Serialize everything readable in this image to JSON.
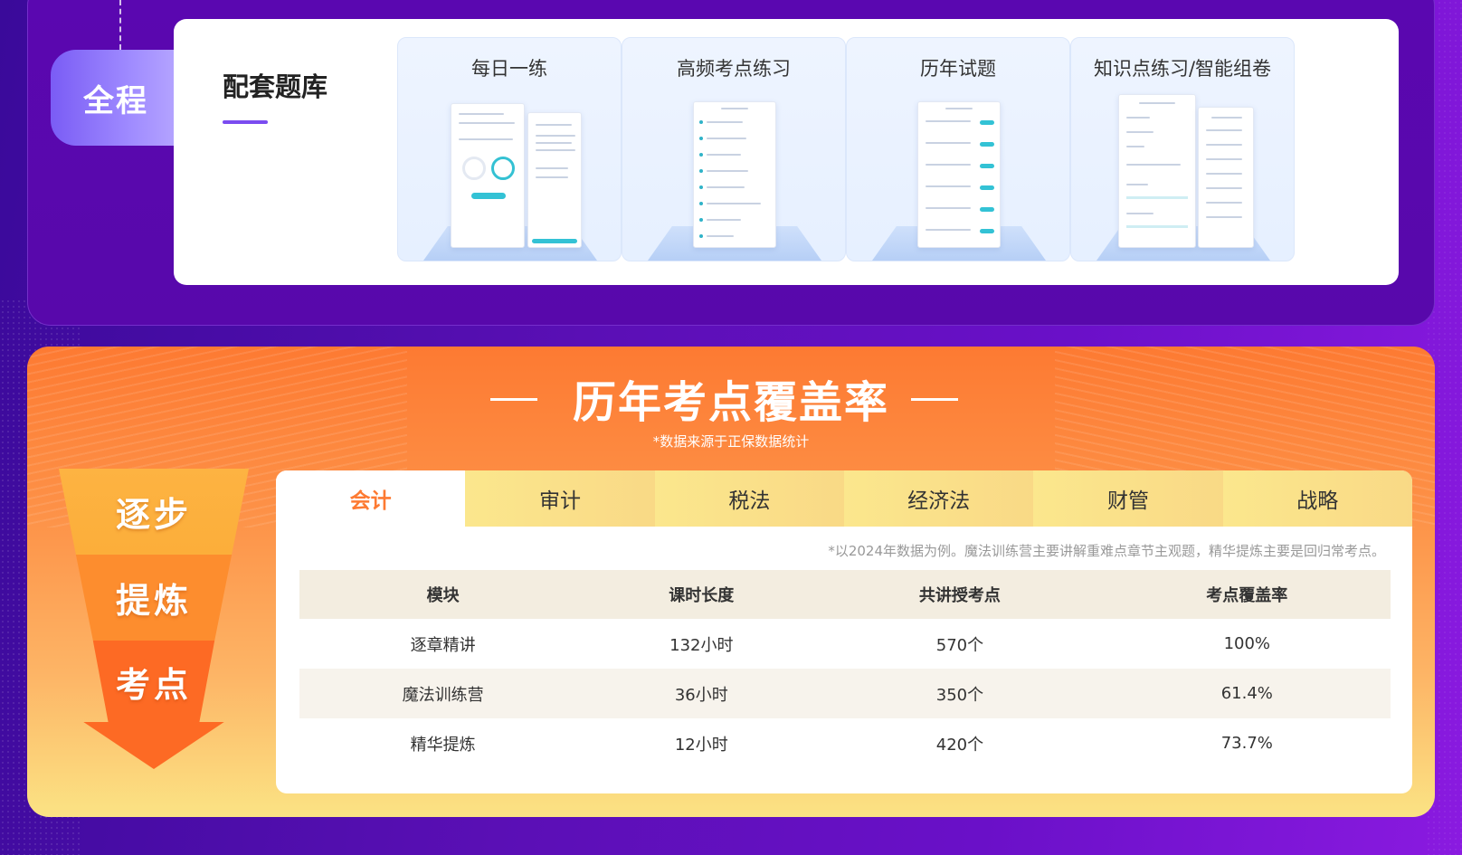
{
  "top": {
    "phase_tag": "全程",
    "section_title": "配套题库",
    "items": [
      {
        "label": "每日一练"
      },
      {
        "label": "高频考点练习"
      },
      {
        "label": "历年试题"
      },
      {
        "label": "知识点练习/智能组卷"
      }
    ]
  },
  "coverage": {
    "title": "历年考点覆盖率",
    "subtitle": "*数据来源于正保数据统计",
    "funnel": [
      "逐步",
      "提炼",
      "考点"
    ],
    "tabs": [
      {
        "label": "会计",
        "active": true
      },
      {
        "label": "审计",
        "active": false
      },
      {
        "label": "税法",
        "active": false
      },
      {
        "label": "经济法",
        "active": false
      },
      {
        "label": "财管",
        "active": false
      },
      {
        "label": "战略",
        "active": false
      }
    ],
    "note": "*以2024年数据为例。魔法训练营主要讲解重难点章节主观题，精华提炼主要是回归常考点。",
    "table": {
      "headers": [
        "模块",
        "课时长度",
        "共讲授考点",
        "考点覆盖率"
      ],
      "rows": [
        [
          "逐章精讲",
          "132小时",
          "570个",
          "100%"
        ],
        [
          "魔法训练营",
          "36小时",
          "350个",
          "61.4%"
        ],
        [
          "精华提炼",
          "12小时",
          "420个",
          "73.7%"
        ]
      ]
    }
  },
  "colors": {
    "accent_orange": "#fd7a32",
    "accent_purple": "#7a4cf0",
    "tab_yellow": "#fbe78d"
  }
}
